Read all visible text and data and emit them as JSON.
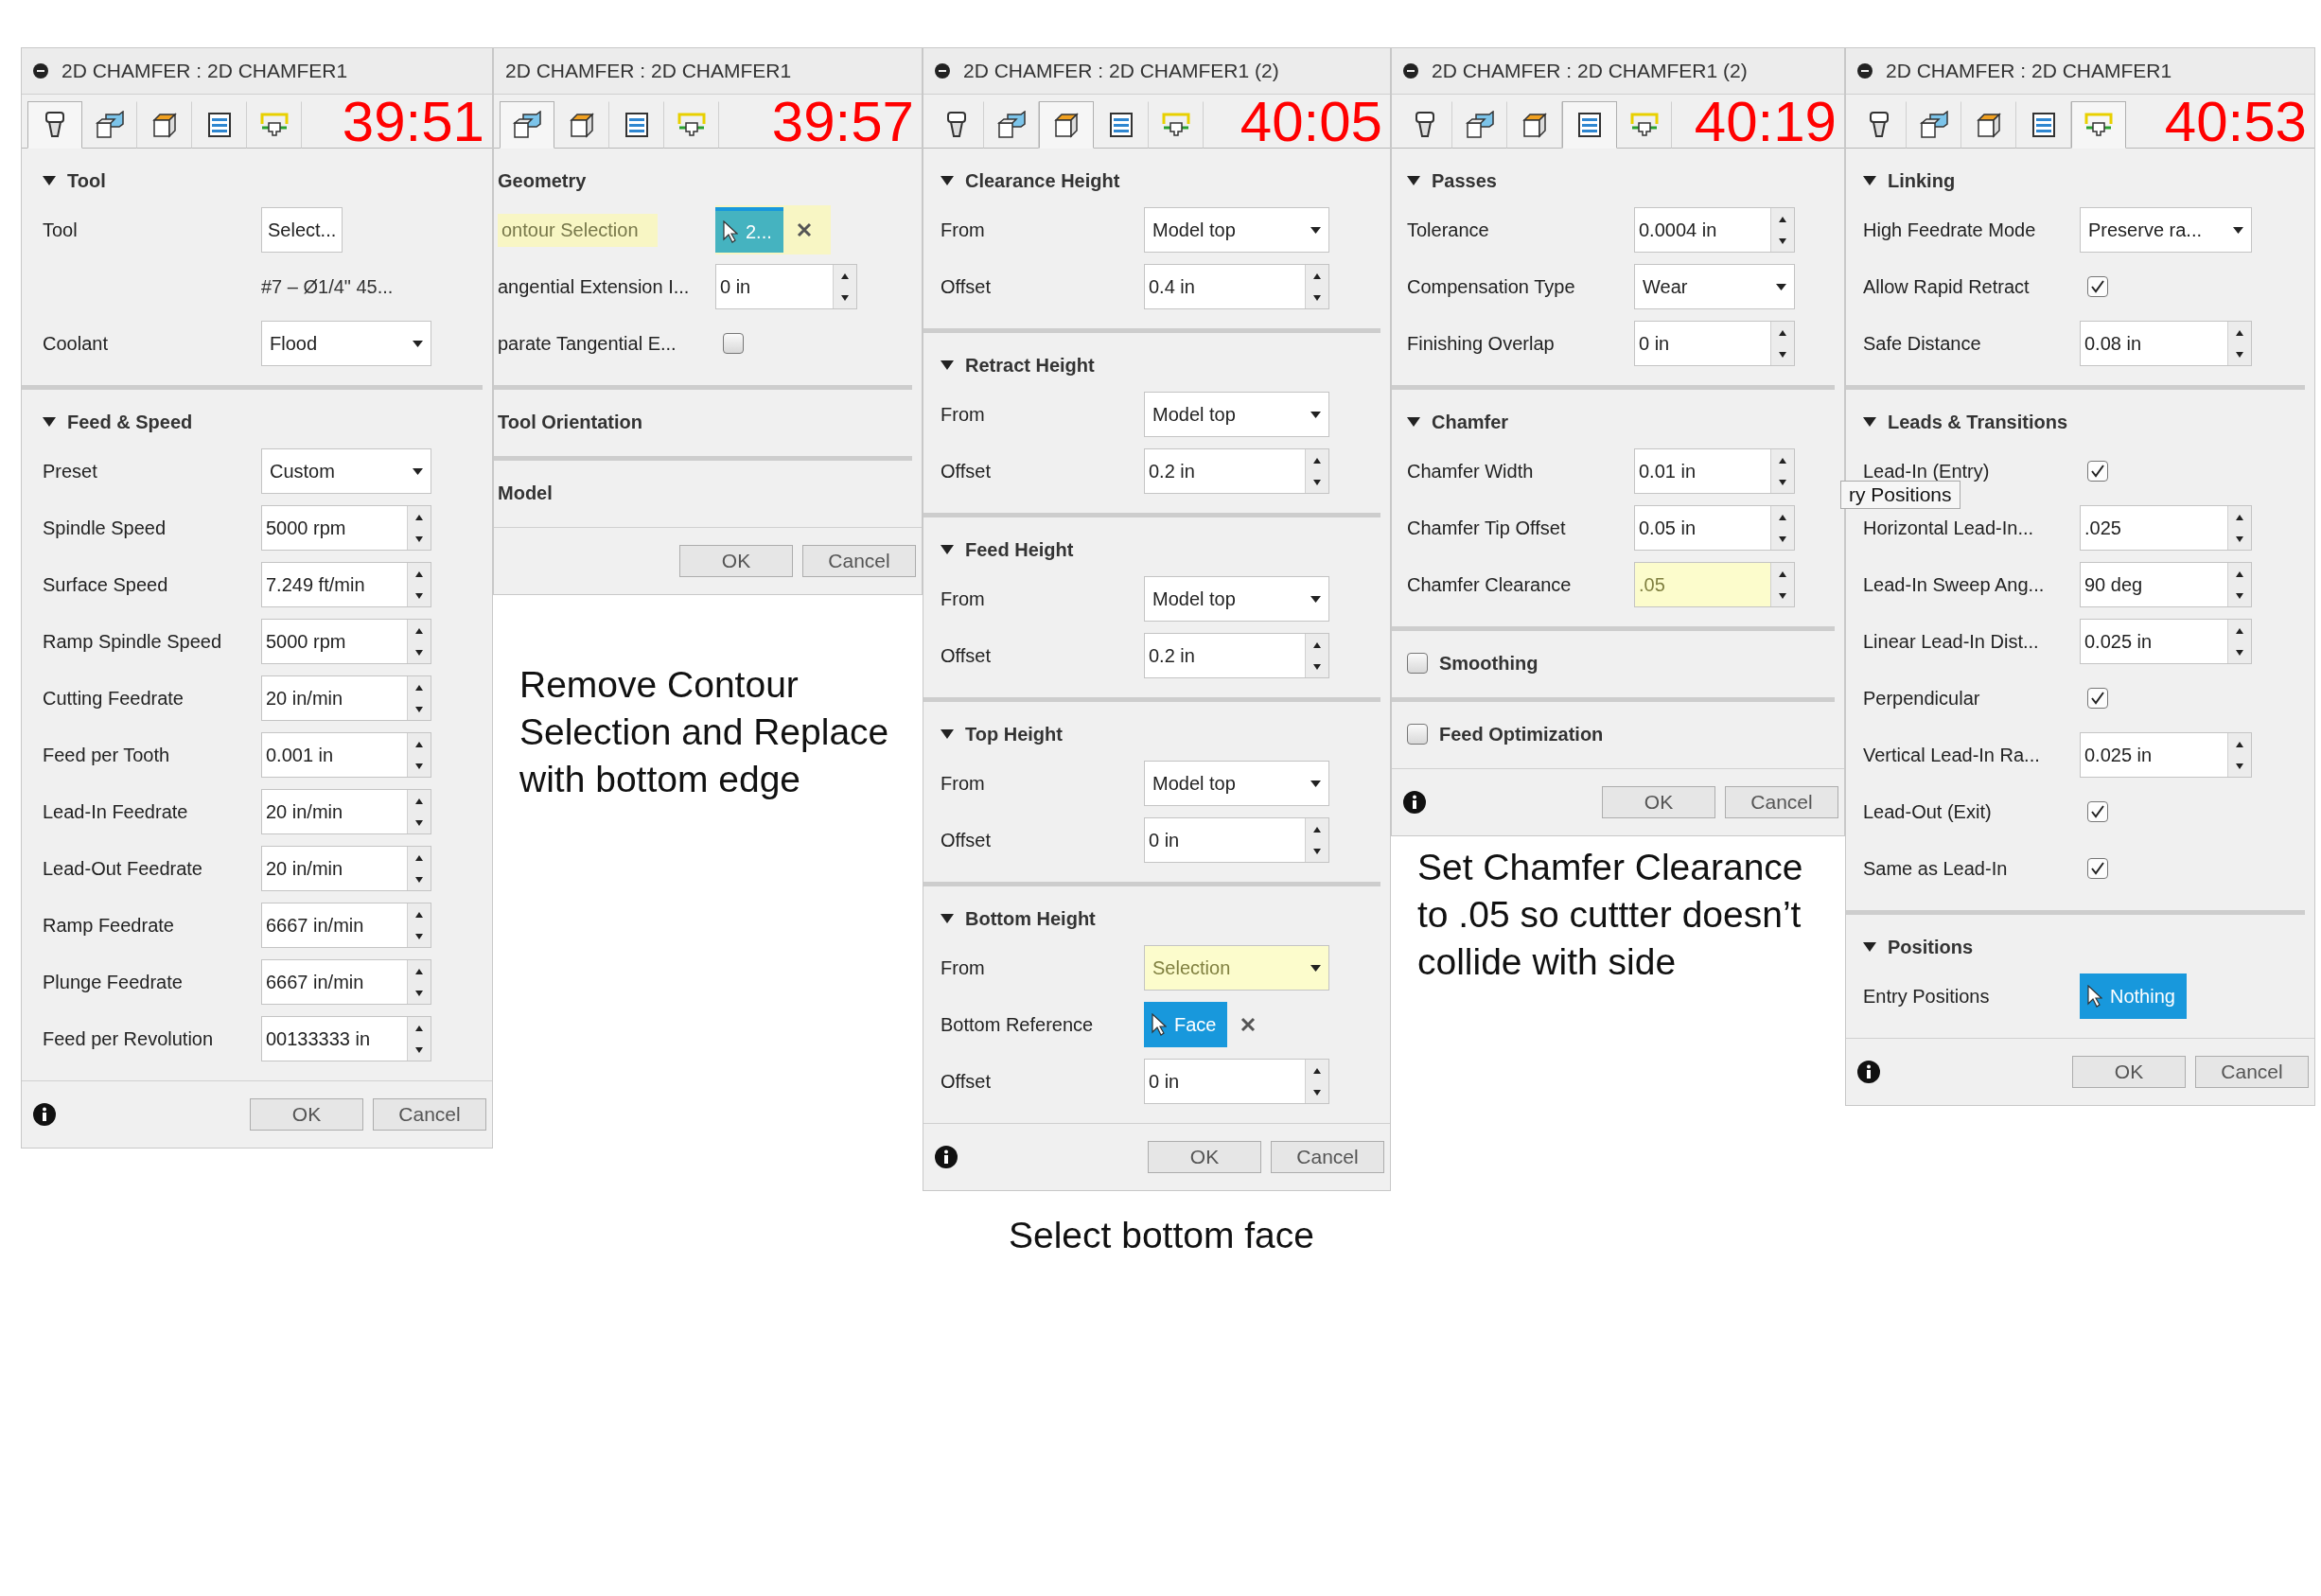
{
  "panels": [
    {
      "title": "2D CHAMFER : 2D CHAMFER1",
      "time": "39:51",
      "tabs": [
        {
          "kind": "tool",
          "selected": true
        },
        {
          "kind": "geometry",
          "selected": false
        },
        {
          "kind": "heights",
          "selected": false
        },
        {
          "kind": "passes",
          "selected": false
        },
        {
          "kind": "linking",
          "selected": false
        }
      ],
      "sections": [
        {
          "title": "Tool",
          "expanded": true,
          "rows": [
            {
              "kind": "button",
              "label": "Tool",
              "value": "Select..."
            },
            {
              "kind": "note",
              "value": "#7 – Ø1/4\" 45..."
            },
            {
              "kind": "dropdown",
              "label": "Coolant",
              "value": "Flood"
            }
          ]
        },
        {
          "title": "Feed & Speed",
          "expanded": true,
          "rows": [
            {
              "kind": "dropdown",
              "label": "Preset",
              "value": "Custom"
            },
            {
              "kind": "spinner",
              "label": "Spindle Speed",
              "value": "5000 rpm"
            },
            {
              "kind": "spinner",
              "label": "Surface Speed",
              "value": "7.249 ft/min"
            },
            {
              "kind": "spinner",
              "label": "Ramp Spindle Speed",
              "value": "5000 rpm"
            },
            {
              "kind": "spinner",
              "label": "Cutting Feedrate",
              "value": "20 in/min"
            },
            {
              "kind": "spinner",
              "label": "Feed per Tooth",
              "value": "0.001 in"
            },
            {
              "kind": "spinner",
              "label": "Lead-In Feedrate",
              "value": "20 in/min"
            },
            {
              "kind": "spinner",
              "label": "Lead-Out Feedrate",
              "value": "20 in/min"
            },
            {
              "kind": "spinner",
              "label": "Ramp Feedrate",
              "value": "6667 in/min"
            },
            {
              "kind": "spinner",
              "label": "Plunge Feedrate",
              "value": "6667 in/min"
            },
            {
              "kind": "spinner",
              "label": "Feed per Revolution",
              "value": "00133333 in"
            }
          ]
        }
      ],
      "info": true,
      "buttons": [
        "OK",
        "Cancel"
      ]
    },
    {
      "title": "2D CHAMFER : 2D CHAMFER1",
      "time": "39:57",
      "tabs": [
        {
          "kind": "geometry",
          "selected": true
        },
        {
          "kind": "heights",
          "selected": false
        },
        {
          "kind": "passes",
          "selected": false
        },
        {
          "kind": "linking",
          "selected": false
        }
      ],
      "sections": [
        {
          "title": "Geometry",
          "rows": [
            {
              "kind": "pick",
              "label": "ontour Selection",
              "label_highlighted": true,
              "value": "2...",
              "highlighted": true,
              "clear": true
            },
            {
              "kind": "spinner",
              "label": "angential Extension I...",
              "value": "0 in"
            },
            {
              "kind": "checkbox",
              "label": "parate Tangential E...",
              "checked": false
            }
          ]
        },
        {
          "title": "Tool Orientation"
        },
        {
          "title": "Model"
        }
      ],
      "info": false,
      "buttons": [
        "OK",
        "Cancel"
      ],
      "caption": "Remove Contour Selection and Replace with bottom edge"
    },
    {
      "title": "2D CHAMFER : 2D CHAMFER1 (2)",
      "time": "40:05",
      "tabs": [
        {
          "kind": "tool",
          "selected": false
        },
        {
          "kind": "geometry",
          "selected": false
        },
        {
          "kind": "heights",
          "selected": true
        },
        {
          "kind": "passes",
          "selected": false
        },
        {
          "kind": "linking",
          "selected": false
        }
      ],
      "sections": [
        {
          "title": "Clearance Height",
          "expanded": true,
          "rows": [
            {
              "kind": "dropdown",
              "label": "From",
              "value": "Model top"
            },
            {
              "kind": "spinner",
              "label": "Offset",
              "value": "0.4 in"
            }
          ]
        },
        {
          "title": "Retract Height",
          "expanded": true,
          "rows": [
            {
              "kind": "dropdown",
              "label": "From",
              "value": "Model top"
            },
            {
              "kind": "spinner",
              "label": "Offset",
              "value": "0.2 in"
            }
          ]
        },
        {
          "title": "Feed Height",
          "expanded": true,
          "rows": [
            {
              "kind": "dropdown",
              "label": "From",
              "value": "Model top"
            },
            {
              "kind": "spinner",
              "label": "Offset",
              "value": "0.2 in"
            }
          ]
        },
        {
          "title": "Top Height",
          "expanded": true,
          "rows": [
            {
              "kind": "dropdown",
              "label": "From",
              "value": "Model top"
            },
            {
              "kind": "spinner",
              "label": "Offset",
              "value": "0 in"
            }
          ]
        },
        {
          "title": "Bottom Height",
          "expanded": true,
          "rows": [
            {
              "kind": "dropdown",
              "label": "From",
              "value": "Selection",
              "highlighted": true
            },
            {
              "kind": "pick",
              "label": "Bottom Reference",
              "value": "Face",
              "clear": true
            },
            {
              "kind": "spinner",
              "label": "Offset",
              "value": "0 in"
            }
          ]
        }
      ],
      "info": true,
      "buttons": [
        "OK",
        "Cancel"
      ],
      "caption": "Select bottom face"
    },
    {
      "title": "2D CHAMFER : 2D CHAMFER1 (2)",
      "time": "40:19",
      "tabs": [
        {
          "kind": "tool",
          "selected": false
        },
        {
          "kind": "geometry",
          "selected": false
        },
        {
          "kind": "heights",
          "selected": false
        },
        {
          "kind": "passes",
          "selected": true
        },
        {
          "kind": "linking",
          "selected": false
        }
      ],
      "sections": [
        {
          "title": "Passes",
          "expanded": true,
          "rows": [
            {
              "kind": "spinner",
              "label": "Tolerance",
              "value": "0.0004 in"
            },
            {
              "kind": "dropdown",
              "label": "Compensation Type",
              "value": "Wear"
            },
            {
              "kind": "spinner",
              "label": "Finishing Overlap",
              "value": "0 in"
            }
          ]
        },
        {
          "title": "Chamfer",
          "expanded": true,
          "rows": [
            {
              "kind": "spinner",
              "label": "Chamfer Width",
              "value": "0.01 in"
            },
            {
              "kind": "spinner",
              "label": "Chamfer Tip Offset",
              "value": "0.05 in"
            },
            {
              "kind": "spinner",
              "label": "Chamfer Clearance",
              "value": ".05",
              "highlighted": true
            }
          ]
        },
        {
          "title": "Smoothing",
          "checked": false
        },
        {
          "title": "Feed Optimization",
          "checked": false
        }
      ],
      "info": true,
      "buttons": [
        "OK",
        "Cancel"
      ],
      "caption": "Set Chamfer Clearance to .05 so cuttter doesn’t collide with side"
    },
    {
      "title": "2D CHAMFER : 2D CHAMFER1",
      "time": "40:53",
      "tabs": [
        {
          "kind": "tool",
          "selected": false
        },
        {
          "kind": "geometry",
          "selected": false
        },
        {
          "kind": "heights",
          "selected": false
        },
        {
          "kind": "passes",
          "selected": false
        },
        {
          "kind": "linking",
          "selected": true
        }
      ],
      "sections": [
        {
          "title": "Linking",
          "expanded": true,
          "rows": [
            {
              "kind": "dropdown",
              "label": "High Feedrate Mode",
              "value": "Preserve ra..."
            },
            {
              "kind": "checkbox",
              "label": "Allow Rapid Retract",
              "checked": true
            },
            {
              "kind": "spinner",
              "label": "Safe Distance",
              "value": "0.08 in"
            }
          ]
        },
        {
          "title": "Leads & Transitions",
          "expanded": true,
          "rows": [
            {
              "kind": "checkbox",
              "label": "Lead-In (Entry)",
              "checked": true,
              "tooltip": "ry Positions"
            },
            {
              "kind": "spinner",
              "label": "Horizontal Lead-In...",
              "value": ".025"
            },
            {
              "kind": "spinner",
              "label": "Lead-In Sweep Ang...",
              "value": "90 deg"
            },
            {
              "kind": "spinner",
              "label": "Linear Lead-In Dist...",
              "value": "0.025 in"
            },
            {
              "kind": "checkbox",
              "label": "Perpendicular",
              "checked": true
            },
            {
              "kind": "spinner",
              "label": "Vertical Lead-In Ra...",
              "value": "0.025 in"
            },
            {
              "kind": "checkbox",
              "label": "Lead-Out (Exit)",
              "checked": true
            },
            {
              "kind": "checkbox",
              "label": "Same as Lead-In",
              "checked": true
            }
          ]
        },
        {
          "title": "Positions",
          "expanded": true,
          "rows": [
            {
              "kind": "pick",
              "label": "Entry Positions",
              "value": "Nothing"
            }
          ]
        }
      ],
      "info": true,
      "buttons": [
        "OK",
        "Cancel"
      ]
    }
  ]
}
